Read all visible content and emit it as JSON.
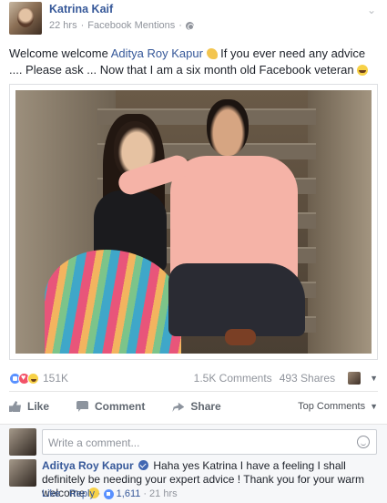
{
  "post": {
    "author": "Katrina Kaif",
    "time": "22 hrs",
    "source": "Facebook Mentions",
    "text_part1": "Welcome welcome ",
    "mention": "Aditya Roy Kapur",
    "text_part2": " If you ever need any advice .... Please ask ... Now that I am a six month old Facebook veteran "
  },
  "reactions": {
    "count": "151K",
    "comments": "1.5K Comments",
    "shares": "493 Shares"
  },
  "actions": {
    "like": "Like",
    "comment": "Comment",
    "share": "Share",
    "top_comments": "Top Comments"
  },
  "composer": {
    "placeholder": "Write a comment..."
  },
  "reply": {
    "author": "Aditya Roy Kapur",
    "text": "Haha yes Katrina I have a feeling I shall definitely be needing your expert advice ! Thank you for your warm welcome ",
    "like": "Like",
    "reply": "Reply",
    "likes": "1,611",
    "time": "21 hrs"
  }
}
